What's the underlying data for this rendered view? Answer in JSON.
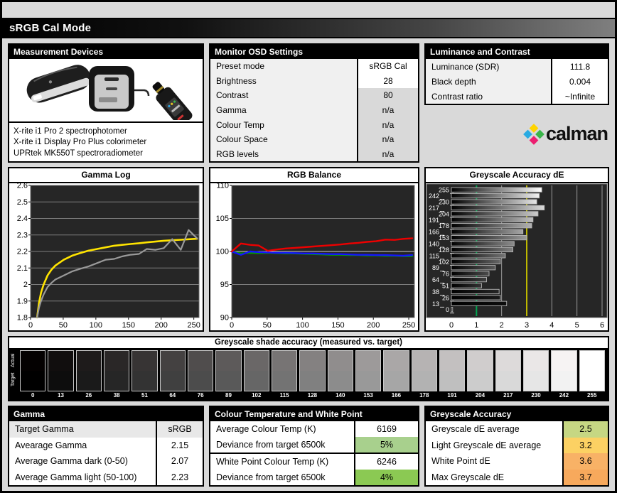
{
  "title": "sRGB Cal Mode",
  "measurement": {
    "header": "Measurement Devices",
    "devices": [
      "X-rite i1 Pro 2 spectrophotomer",
      "X-rite i1 Display Pro Plus colorimeter",
      "UPRtek MK550T spectroradiometer"
    ]
  },
  "osd": {
    "header": "Monitor OSD Settings",
    "rows": [
      {
        "label": "Preset mode",
        "value": "sRGB Cal",
        "value_bg": "#ffffff"
      },
      {
        "label": "Brightness",
        "value": "28",
        "value_bg": "#ffffff"
      },
      {
        "label": "Contrast",
        "value": "80",
        "value_bg": "#d9d9d9"
      },
      {
        "label": "Gamma",
        "value": "n/a",
        "value_bg": "#d9d9d9"
      },
      {
        "label": "Colour Temp",
        "value": "n/a",
        "value_bg": "#d9d9d9"
      },
      {
        "label": "Colour Space",
        "value": "n/a",
        "value_bg": "#d9d9d9"
      },
      {
        "label": "RGB levels",
        "value": "n/a",
        "value_bg": "#d9d9d9"
      }
    ]
  },
  "luminance": {
    "header": "Luminance and Contrast",
    "rows": [
      {
        "label": "Luminance (SDR)",
        "value": "111.8"
      },
      {
        "label": "Black depth",
        "value": "0.004"
      },
      {
        "label": "Contrast ratio",
        "value": "~Infinite"
      }
    ],
    "logo_text": "calman",
    "logo_colors": {
      "top": "#ffd400",
      "left": "#29abe2",
      "right": "#3ab54a",
      "bottom": "#ec1e70"
    }
  },
  "chart_data": [
    {
      "id": "gamma_log",
      "type": "line",
      "title": "Gamma Log",
      "xlim": [
        0,
        258
      ],
      "ylim": [
        1.8,
        2.6
      ],
      "xticks": [
        0,
        50,
        100,
        150,
        200,
        250
      ],
      "yticks": [
        1.8,
        1.9,
        2,
        2.1,
        2.2,
        2.3,
        2.4,
        2.5,
        2.6
      ],
      "grid": true,
      "plot_bg": "#262626",
      "series": [
        {
          "name": "target gamma",
          "color": "#ffe400",
          "width": 2.6,
          "x": [
            10,
            13,
            16,
            20,
            26,
            32,
            38,
            51,
            64,
            76,
            89,
            102,
            115,
            128,
            140,
            153,
            166,
            178,
            191,
            204,
            217,
            230,
            242,
            255
          ],
          "y": [
            1.8,
            1.89,
            1.95,
            2.0,
            2.055,
            2.09,
            2.115,
            2.15,
            2.175,
            2.19,
            2.205,
            2.215,
            2.225,
            2.235,
            2.24,
            2.245,
            2.25,
            2.255,
            2.26,
            2.265,
            2.268,
            2.271,
            2.274,
            2.277
          ]
        },
        {
          "name": "measured gamma",
          "color": "#9a9a9a",
          "width": 2.2,
          "x": [
            10,
            13,
            16,
            20,
            26,
            32,
            38,
            51,
            64,
            76,
            89,
            102,
            115,
            128,
            140,
            153,
            166,
            178,
            191,
            204,
            217,
            230,
            242,
            255
          ],
          "y": [
            1.8,
            1.86,
            1.9,
            1.94,
            1.985,
            2.01,
            2.03,
            2.055,
            2.08,
            2.095,
            2.11,
            2.13,
            2.15,
            2.155,
            2.17,
            2.18,
            2.185,
            2.215,
            2.21,
            2.22,
            2.275,
            2.21,
            2.33,
            2.28
          ]
        }
      ]
    },
    {
      "id": "rgb_balance",
      "type": "line",
      "title": "RGB Balance",
      "xlim": [
        0,
        258
      ],
      "ylim": [
        90,
        110
      ],
      "xticks": [
        0,
        50,
        100,
        150,
        200,
        250
      ],
      "yticks": [
        90,
        95,
        100,
        105,
        110
      ],
      "emphasize": 100,
      "grid": true,
      "plot_bg": "#262626",
      "series": [
        {
          "name": "green",
          "color": "#00a000",
          "width": 2.4,
          "x": [
            0,
            13,
            26,
            38,
            51,
            64,
            76,
            89,
            102,
            115,
            128,
            140,
            153,
            166,
            178,
            191,
            204,
            217,
            230,
            242,
            255
          ],
          "y": [
            100,
            99.7,
            99.8,
            99.75,
            99.8,
            99.75,
            99.7,
            99.7,
            99.65,
            99.6,
            99.55,
            99.5,
            99.5,
            99.45,
            99.45,
            99.4,
            99.4,
            99.35,
            99.35,
            99.3,
            99.3
          ]
        },
        {
          "name": "blue",
          "color": "#1414ff",
          "width": 2.4,
          "x": [
            0,
            13,
            26,
            38,
            51,
            64,
            76,
            89,
            102,
            115,
            128,
            140,
            153,
            166,
            178,
            191,
            204,
            217,
            230,
            242,
            255
          ],
          "y": [
            100,
            99.5,
            100.0,
            99.9,
            99.85,
            99.8,
            99.8,
            99.75,
            99.7,
            99.7,
            99.65,
            99.6,
            99.6,
            99.55,
            99.5,
            99.5,
            99.45,
            99.45,
            99.4,
            99.35,
            99.45
          ]
        },
        {
          "name": "red",
          "color": "#ee0000",
          "width": 2.4,
          "x": [
            0,
            13,
            26,
            38,
            51,
            64,
            76,
            89,
            102,
            115,
            128,
            140,
            153,
            166,
            178,
            191,
            204,
            217,
            230,
            242,
            255
          ],
          "y": [
            100,
            101.2,
            101.0,
            100.9,
            100.1,
            100.3,
            100.45,
            100.55,
            100.65,
            100.75,
            100.85,
            100.95,
            101.05,
            101.2,
            101.3,
            101.45,
            101.55,
            101.8,
            101.75,
            101.9,
            102.0
          ]
        }
      ]
    },
    {
      "id": "greyscale_de",
      "type": "bar",
      "title": "Greyscale Accuracy dE",
      "orientation": "horizontal",
      "xlim": [
        0,
        6
      ],
      "xticks": [
        0,
        1,
        2,
        3,
        4,
        5,
        6
      ],
      "categories": [
        255,
        242,
        230,
        217,
        204,
        191,
        178,
        166,
        153,
        140,
        128,
        115,
        102,
        89,
        76,
        64,
        51,
        38,
        26,
        13,
        0
      ],
      "values": [
        3.6,
        3.5,
        3.4,
        3.7,
        3.45,
        3.25,
        3.2,
        2.85,
        3.0,
        2.5,
        2.45,
        2.15,
        1.95,
        1.75,
        1.5,
        1.4,
        1.2,
        1.9,
        1.95,
        2.2,
        0.05
      ],
      "grid": true,
      "plot_bg": "#262626",
      "reference_lines": [
        {
          "x": 1,
          "color": "#00a550",
          "meaning": "dE 1"
        },
        {
          "x": 3,
          "color": "#bdb800",
          "meaning": "dE 3"
        }
      ]
    }
  ],
  "strip": {
    "title": "Greyscale shade accuracy (measured vs. target)",
    "side_labels": [
      "Actual",
      "Target"
    ],
    "levels": [
      0,
      13,
      26,
      38,
      51,
      64,
      76,
      89,
      102,
      115,
      128,
      140,
      153,
      166,
      178,
      191,
      204,
      217,
      230,
      242,
      255
    ]
  },
  "gamma_table": {
    "header": "Gamma",
    "rows": [
      {
        "label": "Target Gamma",
        "value": "sRGB"
      },
      {
        "label": "Avearage Gamma",
        "value": "2.15"
      },
      {
        "label": "Average Gamma dark (0-50)",
        "value": "2.07"
      },
      {
        "label": "Average Gamma light (50-100)",
        "value": "2.23"
      }
    ]
  },
  "colour_temp": {
    "header": "Colour Temperature and White Point",
    "rows": [
      {
        "label": "Average Colour Temp (K)",
        "value": "6169",
        "value_bg": "#ffffff"
      },
      {
        "label": "Deviance from target 6500k",
        "value": "5%",
        "value_bg": "#a8d08d"
      },
      {
        "label": "White Point Colour Temp (K)",
        "value": "6246",
        "value_bg": "#ffffff"
      },
      {
        "label": "Deviance from target 6500k",
        "value": "4%",
        "value_bg": "#8bc953"
      }
    ]
  },
  "greyscale_table": {
    "header": "Greyscale Accuracy",
    "rows": [
      {
        "label": "Greyscale dE average",
        "value": "2.5",
        "value_bg": "#c6d783"
      },
      {
        "label": "Light Greyscale dE average",
        "value": "3.2",
        "value_bg": "#fcd163"
      },
      {
        "label": "White Point dE",
        "value": "3.6",
        "value_bg": "#f8b266"
      },
      {
        "label": "Max Greyscale dE",
        "value": "3.7",
        "value_bg": "#f7a95c"
      }
    ]
  }
}
